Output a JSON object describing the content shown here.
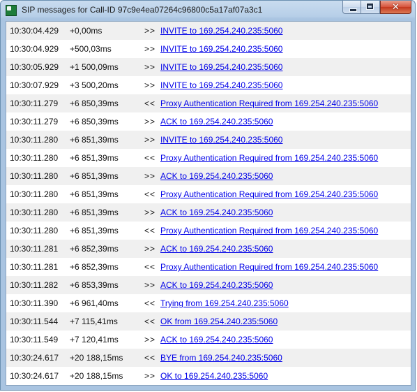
{
  "window": {
    "title": "SIP messages for Call-ID 97c9e4ea07264c96800c5a17af07a3c1",
    "icon_name": "sip-app-icon",
    "controls": {
      "minimize": "minimize",
      "maximize": "maximize",
      "close": "✕"
    }
  },
  "messages": [
    {
      "time": "10:30:04.429",
      "delta": "+0,00ms",
      "direction": ">>",
      "text": "INVITE to 169.254.240.235:5060"
    },
    {
      "time": "10:30:04.929",
      "delta": "+500,03ms",
      "direction": ">>",
      "text": "INVITE to 169.254.240.235:5060"
    },
    {
      "time": "10:30:05.929",
      "delta": "+1 500,09ms",
      "direction": ">>",
      "text": "INVITE to 169.254.240.235:5060"
    },
    {
      "time": "10:30:07.929",
      "delta": "+3 500,20ms",
      "direction": ">>",
      "text": "INVITE to 169.254.240.235:5060"
    },
    {
      "time": "10:30:11.279",
      "delta": "+6 850,39ms",
      "direction": "<<",
      "text": "Proxy Authentication Required from 169.254.240.235:5060"
    },
    {
      "time": "10:30:11.279",
      "delta": "+6 850,39ms",
      "direction": ">>",
      "text": "ACK to 169.254.240.235:5060"
    },
    {
      "time": "10:30:11.280",
      "delta": "+6 851,39ms",
      "direction": ">>",
      "text": "INVITE to 169.254.240.235:5060"
    },
    {
      "time": "10:30:11.280",
      "delta": "+6 851,39ms",
      "direction": "<<",
      "text": "Proxy Authentication Required from 169.254.240.235:5060"
    },
    {
      "time": "10:30:11.280",
      "delta": "+6 851,39ms",
      "direction": ">>",
      "text": "ACK to 169.254.240.235:5060"
    },
    {
      "time": "10:30:11.280",
      "delta": "+6 851,39ms",
      "direction": "<<",
      "text": "Proxy Authentication Required from 169.254.240.235:5060"
    },
    {
      "time": "10:30:11.280",
      "delta": "+6 851,39ms",
      "direction": ">>",
      "text": "ACK to 169.254.240.235:5060"
    },
    {
      "time": "10:30:11.280",
      "delta": "+6 851,39ms",
      "direction": "<<",
      "text": "Proxy Authentication Required from 169.254.240.235:5060"
    },
    {
      "time": "10:30:11.281",
      "delta": "+6 852,39ms",
      "direction": ">>",
      "text": "ACK to 169.254.240.235:5060"
    },
    {
      "time": "10:30:11.281",
      "delta": "+6 852,39ms",
      "direction": "<<",
      "text": "Proxy Authentication Required from 169.254.240.235:5060"
    },
    {
      "time": "10:30:11.282",
      "delta": "+6 853,39ms",
      "direction": ">>",
      "text": "ACK to 169.254.240.235:5060"
    },
    {
      "time": "10:30:11.390",
      "delta": "+6 961,40ms",
      "direction": "<<",
      "text": "Trying from 169.254.240.235:5060"
    },
    {
      "time": "10:30:11.544",
      "delta": "+7 115,41ms",
      "direction": "<<",
      "text": "OK from 169.254.240.235:5060"
    },
    {
      "time": "10:30:11.549",
      "delta": "+7 120,41ms",
      "direction": ">>",
      "text": "ACK to 169.254.240.235:5060"
    },
    {
      "time": "10:30:24.617",
      "delta": "+20 188,15ms",
      "direction": "<<",
      "text": "BYE from 169.254.240.235:5060"
    },
    {
      "time": "10:30:24.617",
      "delta": "+20 188,15ms",
      "direction": ">>",
      "text": "OK to 169.254.240.235:5060"
    }
  ],
  "colors": {
    "link": "#0000e8",
    "row_alt": "#f0f0f0",
    "frame": "#a9c4e1"
  }
}
